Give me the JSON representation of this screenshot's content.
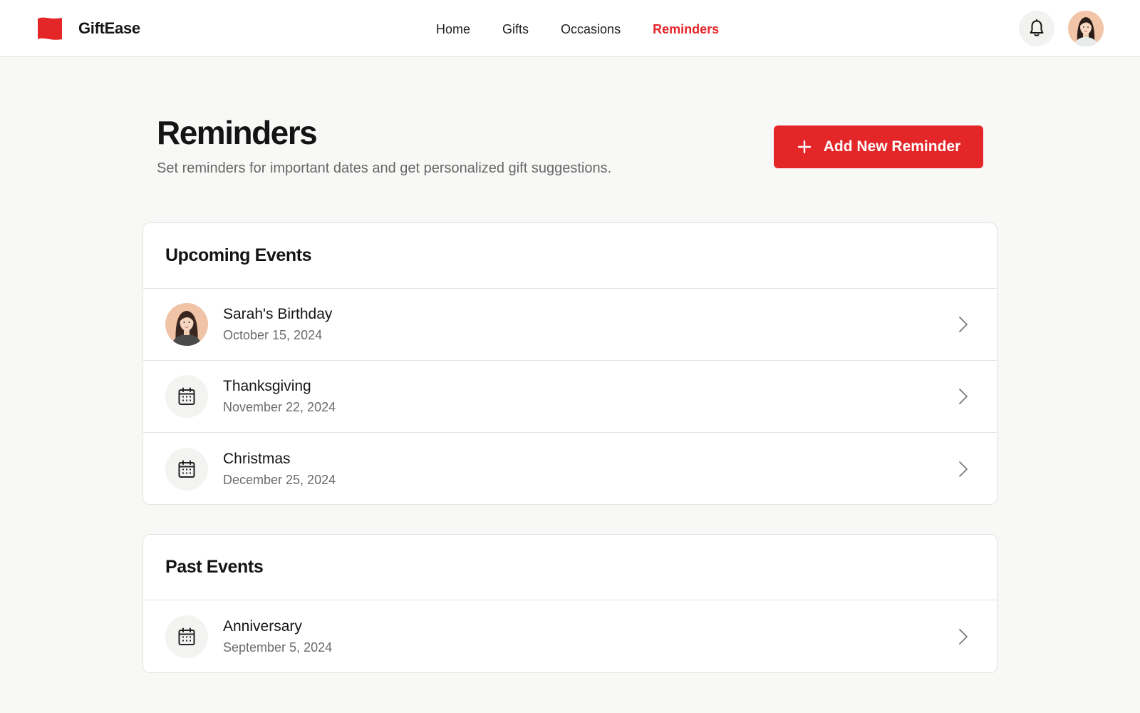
{
  "app": {
    "name": "GiftEase",
    "accent": "#e42629"
  },
  "nav": {
    "links": [
      {
        "label": "Home",
        "active": false
      },
      {
        "label": "Gifts",
        "active": false
      },
      {
        "label": "Occasions",
        "active": false
      },
      {
        "label": "Reminders",
        "active": true
      }
    ]
  },
  "header": {
    "title": "Reminders",
    "subtitle": "Set reminders for important dates and get personalized gift suggestions.",
    "add_button_label": "Add New Reminder"
  },
  "upcoming": {
    "title": "Upcoming Events",
    "events": [
      {
        "name": "Sarah's Birthday",
        "date": "October 15, 2024",
        "icon": "avatar"
      },
      {
        "name": "Thanksgiving",
        "date": "November 22, 2024",
        "icon": "calendar-icon"
      },
      {
        "name": "Christmas",
        "date": "December 25, 2024",
        "icon": "calendar-icon"
      }
    ]
  },
  "past": {
    "title": "Past Events",
    "events": [
      {
        "name": "Anniversary",
        "date": "September 5, 2024",
        "icon": "calendar-icon"
      }
    ]
  }
}
